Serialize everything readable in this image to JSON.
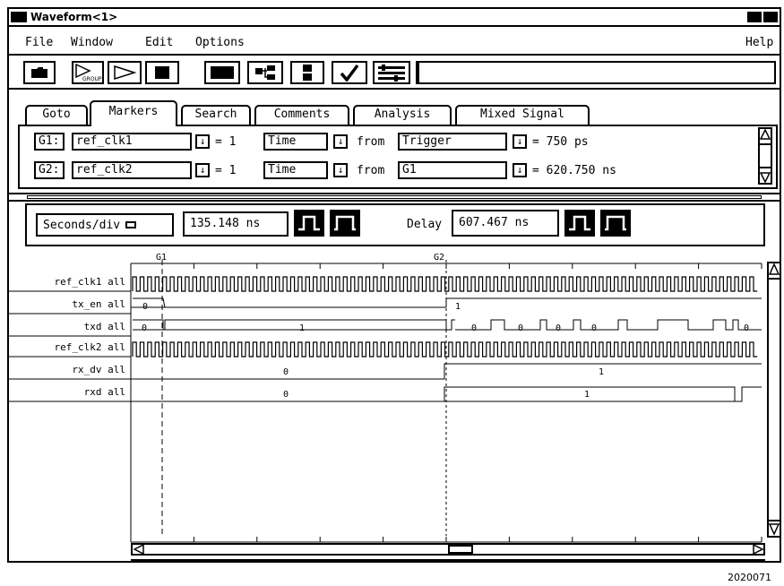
{
  "window": {
    "title": "Waveform<1>"
  },
  "menu": {
    "file": "File",
    "window": "Window",
    "edit": "Edit",
    "options": "Options",
    "help": "Help"
  },
  "toolbar": {
    "group_label": "GROUP",
    "status_text": ""
  },
  "tabs": [
    "Goto",
    "Markers",
    "Search",
    "Comments",
    "Analysis",
    "Mixed Signal"
  ],
  "markers": [
    {
      "id": "G1:",
      "signal": "ref_clk1",
      "occ": "= 1",
      "mode": "Time",
      "from_label": "from",
      "from": "Trigger",
      "value": "= 750 ps"
    },
    {
      "id": "G2:",
      "signal": "ref_clk2",
      "occ": "= 1",
      "mode": "Time",
      "from_label": "from",
      "from": "G1",
      "value": "= 620.750 ns"
    }
  ],
  "timebase": {
    "label": "Seconds/div",
    "value": "135.148 ns",
    "delay_label": "Delay",
    "delay_value": "607.467 ns"
  },
  "ruler": {
    "g1": "G1",
    "g2": "G2"
  },
  "signals": [
    {
      "name": "ref_clk1 all"
    },
    {
      "name": "tx_en all",
      "labels": [
        "0",
        "1"
      ]
    },
    {
      "name": "txd all",
      "labels": [
        "0",
        "1",
        "0",
        "0",
        "0",
        "0",
        "0"
      ]
    },
    {
      "name": "ref_clk2 all"
    },
    {
      "name": "rx_dv all",
      "labels": [
        "0",
        "1"
      ]
    },
    {
      "name": "rxd all",
      "labels": [
        "0",
        "1"
      ]
    }
  ],
  "footer": {
    "figure_id": "2020071"
  },
  "colors": {
    "line": "#000000",
    "background": "#ffffff"
  }
}
